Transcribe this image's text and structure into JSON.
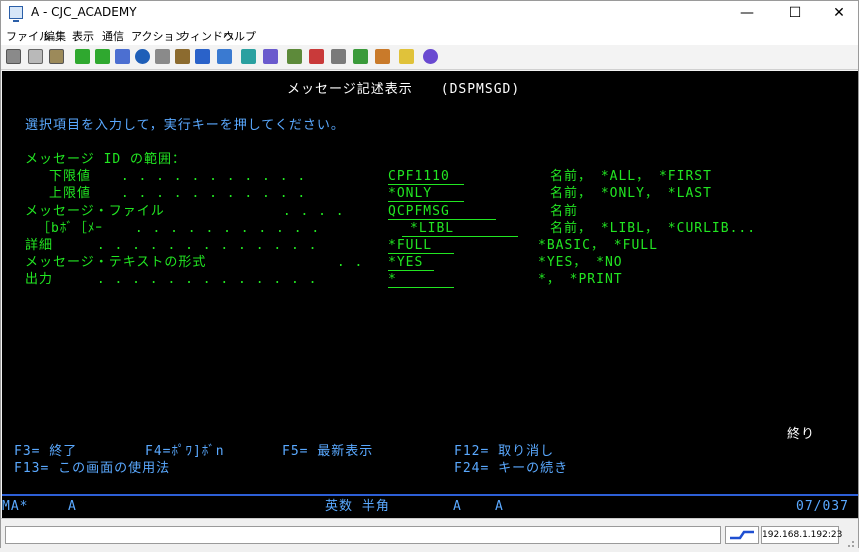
{
  "window": {
    "title": "A - CJC_ACADEMY",
    "minimize": "—",
    "maximize": "☐",
    "close": "✕"
  },
  "menubar": [
    "ファイル",
    "編集",
    "表示",
    "通信",
    "アクション",
    "ウィンドウ",
    "ヘルプ"
  ],
  "toolbar_icons": [
    "print-screen-icon",
    "copy-icon",
    "paste-icon",
    "send-file-icon",
    "receive-file-icon",
    "display-icon",
    "navigate-icon",
    "box-icon",
    "cube-icon",
    "help-icon",
    "grid-icon",
    "table-icon",
    "macro-record-icon",
    "macro-stop-icon",
    "macro-play-icon",
    "macro-run-icon",
    "keyboard-map-icon",
    "notes-icon",
    "question-icon"
  ],
  "screen": {
    "title": "メッセージ記述表示　　(DSPMSGD)",
    "instruction": "選択項目を入力して，実行キーを押してください。",
    "range_label": "メッセージ ID の範囲：",
    "lower_label": "下限値",
    "lower_dots": " . . . . . . . . . . .",
    "lower_value": "CPF1110",
    "lower_hint": "名前， *ALL， *FIRST",
    "upper_label": "上限値",
    "upper_dots": " . . . . . . . . . . .",
    "upper_value": "*ONLY",
    "upper_hint": "名前， *ONLY， *LAST",
    "msgfile_label": "メッセージ・ファイル",
    "msgfile_dots": " . . . .",
    "msgfile_value": "QCPFMSG",
    "msgfile_hint": "名前",
    "library_label": "［bﾎﾞ［ﾒｰ",
    "library_dots": " . . . . . . . . . . .",
    "library_value": "*LIBL",
    "library_hint": "名前， *LIBL， *CURLIB...",
    "detail_label": "詳細",
    "detail_dots": " . . . . . . . . . . . . .",
    "detail_value": "*FULL",
    "detail_hint": "*BASIC， *FULL",
    "format_label": "メッセージ・テキストの形式",
    "format_dots": " . .",
    "format_value": "*YES",
    "format_hint": "*YES， *NO",
    "output_label": "出力",
    "output_dots": " . . . . . . . . . . . . .",
    "output_value": "*",
    "output_hint": "*， *PRINT",
    "bottom_status": "終り",
    "fkeys": {
      "f3": "F3= 終了",
      "f4": "F4=ﾎﾟﾜ]ﾎﾞn",
      "f5": "F5= 最新表示",
      "f12": "F12= 取り消し",
      "f13": "F13= この画面の使用法",
      "f24": "F24= キーの続き"
    }
  },
  "oia": {
    "left": "MA*",
    "session": "A",
    "ime": "英数 半角",
    "indicator1": "A",
    "indicator2": "A",
    "cursor_pos": "07/037"
  },
  "statusbar": {
    "ip": "192.168.1.192:23"
  }
}
